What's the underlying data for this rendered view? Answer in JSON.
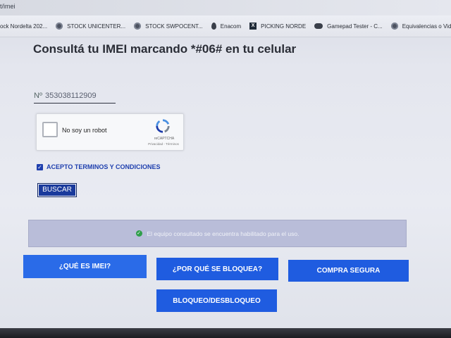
{
  "browser": {
    "url_fragment": "t/imei",
    "bookmarks": [
      {
        "label": "ock Nordelta 202...",
        "icon": "folder-icon"
      },
      {
        "label": "STOCK UNICENTER...",
        "icon": "globe-icon"
      },
      {
        "label": "STOCK SWPOCENT...",
        "icon": "globe-icon"
      },
      {
        "label": "Enacom",
        "icon": "drop-icon"
      },
      {
        "label": "PICKING NORDE",
        "icon": "excel-icon"
      },
      {
        "label": "Gamepad Tester - C...",
        "icon": "gamepad-icon"
      },
      {
        "label": "Equivalencias o Vid",
        "icon": "globe-icon"
      }
    ]
  },
  "page": {
    "headline": "Consultá tu IMEI marcando *#06# en tu celular",
    "imei_field": {
      "prefix": "Nº",
      "value": "353038112909"
    },
    "recaptcha": {
      "label": "No soy un robot",
      "brand": "reCAPTCHA",
      "links": "Privacidad - Términos"
    },
    "terms_label": "ACEPTO TERMINOS Y CONDICIONES",
    "search_button": "BUSCAR",
    "alert": "El equipo consultado se encuentra habilitado para el uso.",
    "nav_buttons": [
      "¿QUÉ ES IMEI?",
      "¿POR QUÉ SE BLOQUEA?",
      "COMPRA SEGURA",
      "BLOQUEO/DESBLOQUEO"
    ]
  },
  "colors": {
    "primary": "#1f5ce0",
    "dark_button": "#1a3a9c",
    "alert_bg": "#b9bdd9",
    "success": "#2f9e4a"
  }
}
